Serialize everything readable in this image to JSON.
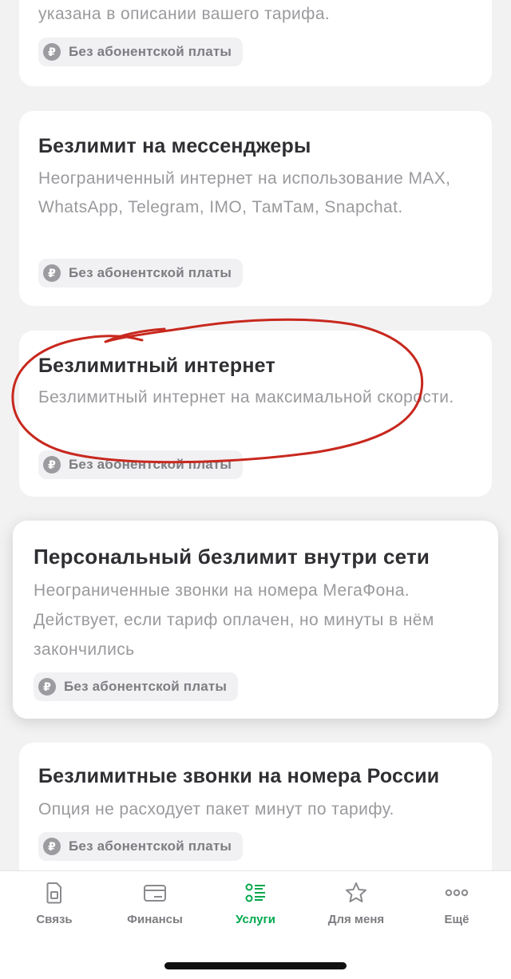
{
  "cards": [
    {
      "title": "",
      "description": "указана в описании вашего тарифа.",
      "chip": "Без абонентской платы"
    },
    {
      "title": "Безлимит на мессенджеры",
      "description": "Неограниченный интернет на использование MAX, WhatsApp, Telegram, IMO, ТамТам, Snapchat.",
      "chip": "Без абонентской платы"
    },
    {
      "title": "Безлимитный интернет",
      "description": "Безлимитный интернет на максимальной скорости.",
      "chip": "Без абонентской платы"
    },
    {
      "title": "Персональный безлимит внутри сети",
      "description": "Неограниченные звонки на номера МегаФона. Действует, если тариф оплачен, но минуты в нём закончились",
      "chip": "Без абонентской платы"
    },
    {
      "title": "Безлимитные звонки на номера России",
      "description": "Опция не расходует пакет минут по тарифу.",
      "chip": "Без абонентской платы"
    }
  ],
  "chip_icon": "ruble-icon",
  "tabbar": {
    "tabs": [
      {
        "label": "Связь",
        "icon": "sim-card-icon",
        "active": false
      },
      {
        "label": "Финансы",
        "icon": "wallet-icon",
        "active": false
      },
      {
        "label": "Услуги",
        "icon": "services-list-icon",
        "active": true
      },
      {
        "label": "Для меня",
        "icon": "star-icon",
        "active": false
      },
      {
        "label": "Ещё",
        "icon": "more-dots-icon",
        "active": false
      }
    ]
  },
  "colors": {
    "accent": "#00a84d",
    "annotation": "#c8281e",
    "background": "#f2f2f3"
  }
}
